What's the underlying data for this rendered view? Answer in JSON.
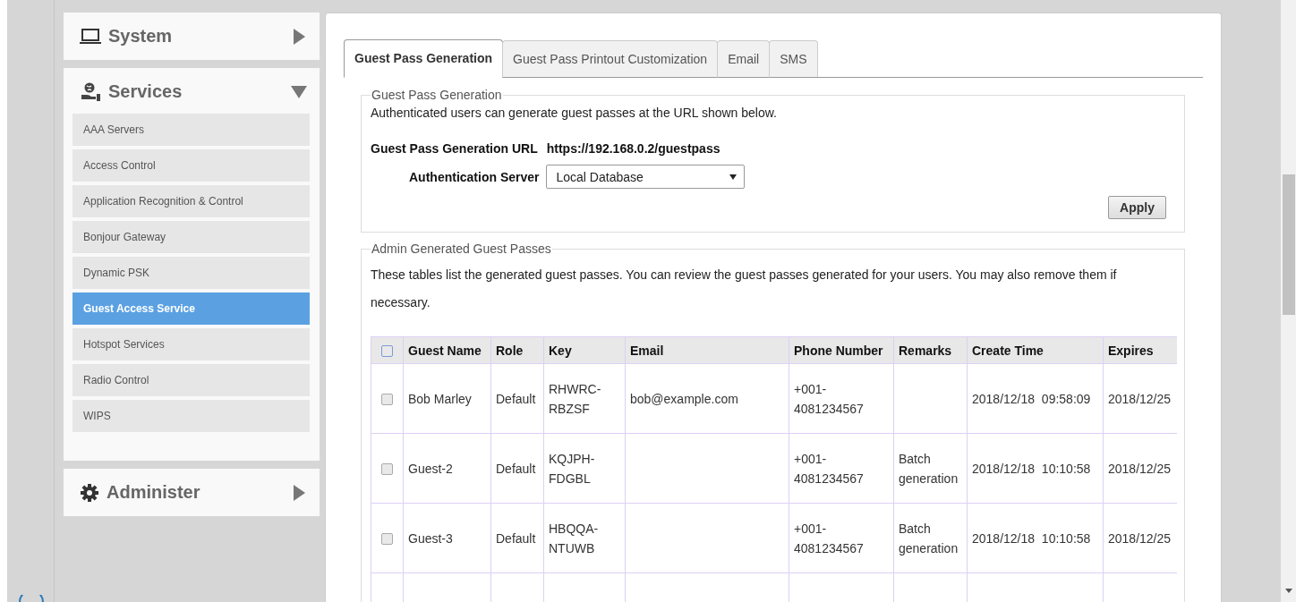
{
  "sidebar": {
    "sections": [
      {
        "title": "System",
        "expanded": false
      },
      {
        "title": "Services",
        "expanded": true,
        "items": [
          {
            "label": "AAA Servers",
            "selected": false
          },
          {
            "label": "Access Control",
            "selected": false
          },
          {
            "label": "Application Recognition & Control",
            "selected": false
          },
          {
            "label": "Bonjour Gateway",
            "selected": false
          },
          {
            "label": "Dynamic PSK",
            "selected": false
          },
          {
            "label": "Guest Access Service",
            "selected": true
          },
          {
            "label": "Hotspot Services",
            "selected": false
          },
          {
            "label": "Radio Control",
            "selected": false
          },
          {
            "label": "WIPS",
            "selected": false
          }
        ]
      },
      {
        "title": "Administer",
        "expanded": false
      }
    ]
  },
  "tabs": [
    {
      "label": "Guest Pass Generation",
      "selected": true
    },
    {
      "label": "Guest Pass Printout Customization",
      "selected": false
    },
    {
      "label": "Email",
      "selected": false
    },
    {
      "label": "SMS",
      "selected": false
    }
  ],
  "generation": {
    "legend": "Guest Pass Generation",
    "description": "Authenticated users can generate guest passes at the URL shown below.",
    "url_label": "Guest Pass Generation URL",
    "url": "https://192.168.0.2/guestpass",
    "server_label": "Authentication Server",
    "server_value": "Local Database",
    "apply": "Apply"
  },
  "passes": {
    "legend": "Admin Generated Guest Passes",
    "description": "These tables list the generated guest passes. You can review the guest passes generated for your users. You may also remove them if necessary.",
    "table": {
      "select_all_checked": false,
      "columns": [
        "Guest Name",
        "Role",
        "Key",
        "Email",
        "Phone Number",
        "Remarks",
        "Create Time",
        "Expires"
      ],
      "rows": [
        {
          "checked": false,
          "cells": [
            "Bob Marley",
            "Default",
            "RHWRC-RBZSF",
            "bob@example.com",
            "+001-4081234567",
            "",
            "2018/12/18  09:58:09",
            "2018/12/25"
          ]
        },
        {
          "checked": false,
          "cells": [
            "Guest-2",
            "Default",
            "KQJPH-FDGBL",
            "",
            "+001-4081234567",
            "Batch generation",
            "2018/12/18  10:10:58",
            "2018/12/25"
          ]
        },
        {
          "checked": false,
          "cells": [
            "Guest-3",
            "Default",
            "HBQQA-NTUWB",
            "",
            "+001-4081234567",
            "Batch generation",
            "2018/12/18  10:10:58",
            "2018/12/25"
          ]
        }
      ]
    }
  }
}
